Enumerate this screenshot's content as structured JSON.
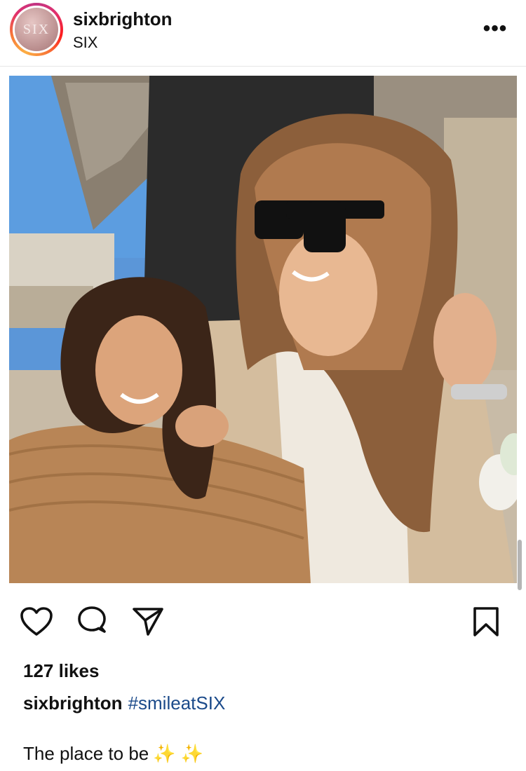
{
  "header": {
    "username": "sixbrighton",
    "subtitle": "SIX",
    "avatar_text": "SIX",
    "more_label": "•••"
  },
  "post": {
    "image_icon": "photo-image",
    "likes": "127 likes",
    "caption_author": "sixbrighton",
    "caption_hashtag": "#smileatSIX",
    "text": "The place to be",
    "emoji": "✨ ✨"
  },
  "actions": {
    "like_icon": "heart-icon",
    "comment_icon": "comment-icon",
    "share_icon": "send-icon",
    "save_icon": "bookmark-icon"
  },
  "colors": {
    "hashtag": "#1b4a8a",
    "text": "#111111",
    "divider": "#e6e6e6"
  }
}
